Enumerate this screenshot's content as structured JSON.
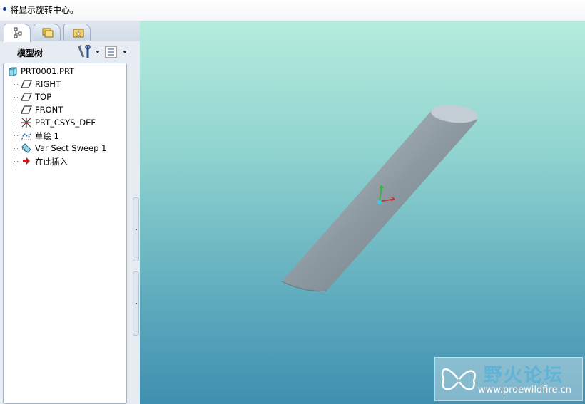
{
  "message_bar": {
    "text": "将显示旋转中心。"
  },
  "model_tree": {
    "title": "模型树",
    "root": "PRT0001.PRT",
    "items": [
      {
        "label": "RIGHT",
        "icon": "datum-plane-icon"
      },
      {
        "label": "TOP",
        "icon": "datum-plane-icon"
      },
      {
        "label": "FRONT",
        "icon": "datum-plane-icon"
      },
      {
        "label": "PRT_CSYS_DEF",
        "icon": "coordinate-system-icon"
      },
      {
        "label": "草绘 1",
        "icon": "sketch-icon"
      },
      {
        "label": "Var Sect Sweep 1",
        "icon": "sweep-feature-icon"
      },
      {
        "label": "在此插入",
        "icon": "insert-here-arrow-icon"
      }
    ]
  },
  "watermark": {
    "title": "野火论坛",
    "url": "www.proewildfire.cn"
  },
  "colors": {
    "viewport_top": "#b5ecdd",
    "viewport_bottom": "#3f8fb0",
    "part": "#8e9aa2"
  }
}
